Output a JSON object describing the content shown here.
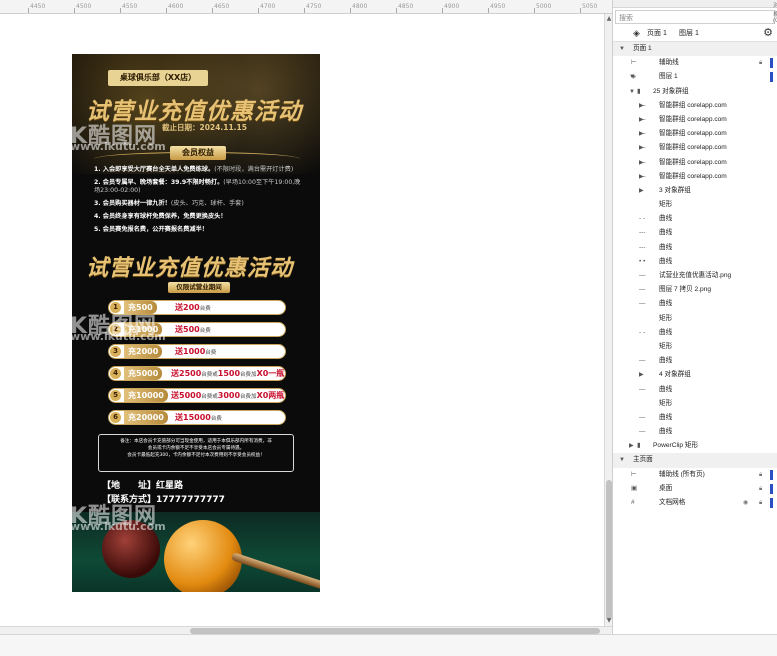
{
  "ruler": {
    "ticks": [
      "4450",
      "4500",
      "4550",
      "4600",
      "4650",
      "4700",
      "4750",
      "4800",
      "4850",
      "4900",
      "4950",
      "5000",
      "5050"
    ]
  },
  "poster": {
    "club_badge": "桌球俱乐部（XX店）",
    "title": "试营业充值优惠活动",
    "end_date": "截止日期：2024.11.15",
    "section_title": "会员权益",
    "benefits": [
      {
        "text": "1. 入会即享受大厅赛台全天单人免费练球。",
        "sub": "(不限时段，满台需开灯计费)"
      },
      {
        "text": "2. 会员专属早、晚场套餐：39.9不限时畅打。",
        "sub": "(早场10:00至下午19:00,晚场23:00-02:00)"
      },
      {
        "text": "3. 会员购买器材一律九折！",
        "sub": "(皮头、巧克、球杆、手套)"
      },
      {
        "text": "4. 会员终身享有球杆免费保养，免费更换皮头！",
        "sub": ""
      },
      {
        "text": "5. 会员赛免报名费，公开赛报名费减半！",
        "sub": ""
      }
    ],
    "title2": "试营业充值优惠活动",
    "period_badge": "仅限试营业期间",
    "tiers": [
      {
        "num": "1",
        "charge": "充500",
        "value": "送200",
        "suffix": "台费"
      },
      {
        "num": "2",
        "charge": "充1000",
        "value": "送500",
        "suffix": "台费"
      },
      {
        "num": "3",
        "charge": "充2000",
        "value": "送1000",
        "suffix": "台费"
      },
      {
        "num": "4",
        "charge": "充5000",
        "value": "送2500",
        "suffix": "台费或",
        "value2": "1500",
        "suffix2": "台费加",
        "extra": "X0一瓶"
      },
      {
        "num": "5",
        "charge": "充10000",
        "value": "送5000",
        "suffix": "台费或",
        "value2": "3000",
        "suffix2": "台费加",
        "extra": "X0两瓶"
      },
      {
        "num": "6",
        "charge": "充20000",
        "value": "送15000",
        "suffix": "台费"
      }
    ],
    "note_lines": [
      "备注：本店会员卡充值部分可当现金使用，适用于本俱乐部内所有消费，非",
      "会员或卡内余额不足不享受本店会员专属待遇。",
      "会员卡最低起充300，卡内余额不足付本次费用则不享受会员权益！"
    ],
    "address": "【地　　址】红星路",
    "phone": "【联系方式】17777777777",
    "watermark_logo": "K酷图网",
    "watermark_url": "www.ikutu.com"
  },
  "panel": {
    "header": "对象(O)",
    "search_placeholder": "搜索",
    "page_tab": "页面 1",
    "layer_tab": "图层 1",
    "tree": [
      {
        "depth": 0,
        "kind": "head",
        "expander": "▼",
        "icon": "",
        "label": "页面 1"
      },
      {
        "depth": 1,
        "kind": "row",
        "expander": "",
        "icon": "⊢",
        "label": "辅助线",
        "lock": true,
        "bar": true
      },
      {
        "depth": 1,
        "kind": "row",
        "expander": "▼",
        "icon": "◈",
        "label": "图层 1",
        "bar": true
      },
      {
        "depth": 2,
        "kind": "row",
        "expander": "▼",
        "icon": "▮",
        "label": "25 对象群组"
      },
      {
        "depth": 3,
        "kind": "row",
        "expander": "▶",
        "icon": "—",
        "label": "智能群组 corelapp.com"
      },
      {
        "depth": 3,
        "kind": "row",
        "expander": "▶",
        "icon": "—",
        "label": "智能群组 corelapp.com"
      },
      {
        "depth": 3,
        "kind": "row",
        "expander": "▶",
        "icon": "—",
        "label": "智能群组 corelapp.com"
      },
      {
        "depth": 3,
        "kind": "row",
        "expander": "▶",
        "icon": "—",
        "label": "智能群组 corelapp.com"
      },
      {
        "depth": 3,
        "kind": "row",
        "expander": "▶",
        "icon": "—",
        "label": "智能群组 corelapp.com"
      },
      {
        "depth": 3,
        "kind": "row",
        "expander": "▶",
        "icon": "—",
        "label": "智能群组 corelapp.com"
      },
      {
        "depth": 3,
        "kind": "row",
        "expander": "▶",
        "icon": "",
        "label": "3 对象群组"
      },
      {
        "depth": 3,
        "kind": "row",
        "expander": "",
        "icon": "",
        "label": "矩形"
      },
      {
        "depth": 3,
        "kind": "row",
        "expander": "",
        "icon": "- -",
        "label": "曲线"
      },
      {
        "depth": 3,
        "kind": "row",
        "expander": "",
        "icon": "---",
        "label": "曲线"
      },
      {
        "depth": 3,
        "kind": "row",
        "expander": "",
        "icon": "---",
        "label": "曲线"
      },
      {
        "depth": 3,
        "kind": "row",
        "expander": "",
        "icon": "• •",
        "label": "曲线"
      },
      {
        "depth": 3,
        "kind": "row",
        "expander": "",
        "icon": "—",
        "label": "试营业充值优惠活动.png"
      },
      {
        "depth": 3,
        "kind": "row",
        "expander": "",
        "icon": "—",
        "label": "图层 7 拷贝 2.png"
      },
      {
        "depth": 3,
        "kind": "row",
        "expander": "",
        "icon": "—",
        "label": "曲线"
      },
      {
        "depth": 3,
        "kind": "row",
        "expander": "",
        "icon": "",
        "label": "矩形"
      },
      {
        "depth": 3,
        "kind": "row",
        "expander": "",
        "icon": "- -",
        "label": "曲线"
      },
      {
        "depth": 3,
        "kind": "row",
        "expander": "",
        "icon": "",
        "label": "矩形"
      },
      {
        "depth": 3,
        "kind": "row",
        "expander": "",
        "icon": "—",
        "label": "曲线"
      },
      {
        "depth": 3,
        "kind": "row",
        "expander": "▶",
        "icon": "",
        "label": "4 对象群组"
      },
      {
        "depth": 3,
        "kind": "row",
        "expander": "",
        "icon": "—",
        "label": "曲线"
      },
      {
        "depth": 3,
        "kind": "row",
        "expander": "",
        "icon": "",
        "label": "矩形"
      },
      {
        "depth": 3,
        "kind": "row",
        "expander": "",
        "icon": "—",
        "label": "曲线"
      },
      {
        "depth": 3,
        "kind": "row",
        "expander": "",
        "icon": "—",
        "label": "曲线"
      },
      {
        "depth": 2,
        "kind": "row",
        "expander": "▶",
        "icon": "▮",
        "label": "PowerClip 矩形"
      },
      {
        "depth": 0,
        "kind": "head",
        "expander": "▼",
        "icon": "",
        "label": "主页面"
      },
      {
        "depth": 1,
        "kind": "row",
        "expander": "",
        "icon": "⊢",
        "label": "辅助线 (所有页)",
        "lock": true,
        "bar": true
      },
      {
        "depth": 1,
        "kind": "row",
        "expander": "",
        "icon": "▣",
        "label": "桌面",
        "lock": true,
        "bar": true
      },
      {
        "depth": 1,
        "kind": "row",
        "expander": "",
        "icon": "#",
        "label": "文档网格",
        "eye": true,
        "lock": true,
        "bar": true
      }
    ]
  }
}
